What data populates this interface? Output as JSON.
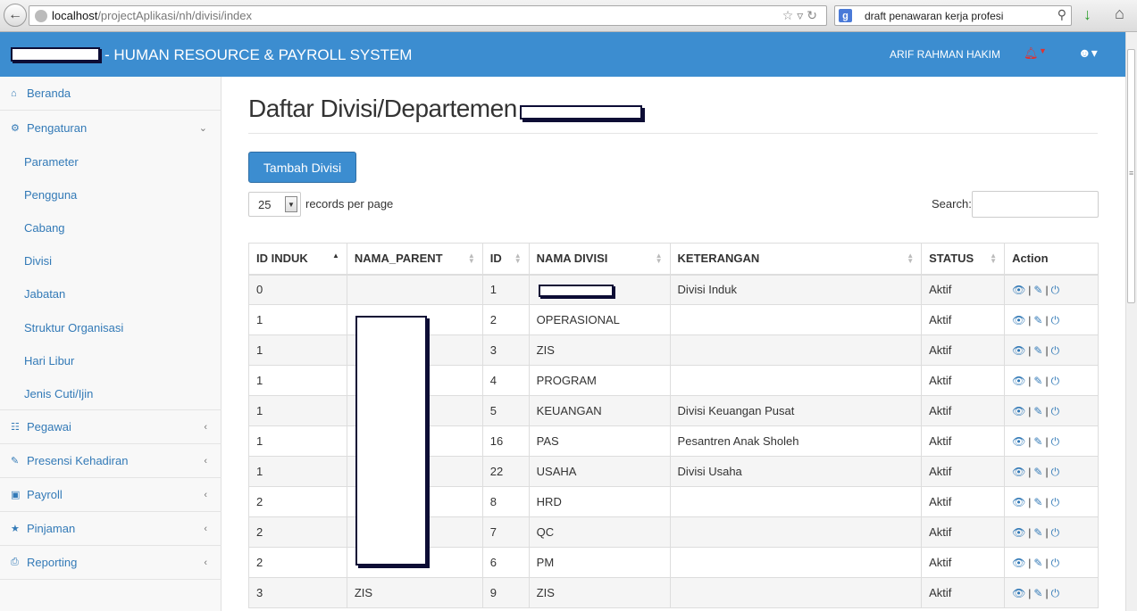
{
  "browser": {
    "url_host": "localhost",
    "url_path": "/projectAplikasi/nh/divisi/index",
    "search_query": "draft penawaran kerja profesi"
  },
  "header": {
    "title": "- HUMAN RESOURCE & PAYROLL SYSTEM",
    "user_name": "ARIF RAHMAN HAKIM",
    "brand_color": "#3c8dd0"
  },
  "sidebar": {
    "items": [
      {
        "label": "Beranda",
        "icon": "home-icon"
      },
      {
        "label": "Pengaturan",
        "icon": "cogs-icon"
      },
      {
        "label": "Pegawai",
        "icon": "sitemap-icon"
      },
      {
        "label": "Presensi Kehadiran",
        "icon": "edit-icon"
      },
      {
        "label": "Payroll",
        "icon": "money-icon"
      },
      {
        "label": "Pinjaman",
        "icon": "star-icon"
      },
      {
        "label": "Reporting",
        "icon": "print-icon"
      }
    ],
    "subitems": [
      "Parameter",
      "Pengguna",
      "Cabang",
      "Divisi",
      "Jabatan",
      "Struktur Organisasi",
      "Hari Libur",
      "Jenis Cuti/Ijin"
    ]
  },
  "main": {
    "title": "Daftar Divisi/Departemen",
    "add_button": "Tambah Divisi",
    "records_per_page_value": "25",
    "records_per_page_label": "records per page",
    "search_label": "Search:",
    "columns": [
      "ID INDUK",
      "NAMA_PARENT",
      "ID",
      "NAMA DIVISI",
      "KETERANGAN",
      "STATUS",
      "Action"
    ],
    "rows": [
      {
        "id_induk": "0",
        "nama_parent": "",
        "id": "1",
        "nama_divisi": "",
        "keterangan": "Divisi Induk",
        "status": "Aktif"
      },
      {
        "id_induk": "1",
        "nama_parent": "",
        "id": "2",
        "nama_divisi": "OPERASIONAL",
        "keterangan": "",
        "status": "Aktif"
      },
      {
        "id_induk": "1",
        "nama_parent": "",
        "id": "3",
        "nama_divisi": "ZIS",
        "keterangan": "",
        "status": "Aktif"
      },
      {
        "id_induk": "1",
        "nama_parent": "",
        "id": "4",
        "nama_divisi": "PROGRAM",
        "keterangan": "",
        "status": "Aktif"
      },
      {
        "id_induk": "1",
        "nama_parent": "",
        "id": "5",
        "nama_divisi": "KEUANGAN",
        "keterangan": "Divisi Keuangan Pusat",
        "status": "Aktif"
      },
      {
        "id_induk": "1",
        "nama_parent": "",
        "id": "16",
        "nama_divisi": "PAS",
        "keterangan": "Pesantren Anak Sholeh",
        "status": "Aktif"
      },
      {
        "id_induk": "1",
        "nama_parent": "",
        "id": "22",
        "nama_divisi": "USAHA",
        "keterangan": "Divisi Usaha",
        "status": "Aktif"
      },
      {
        "id_induk": "2",
        "nama_parent": "",
        "id": "8",
        "nama_divisi": "HRD",
        "keterangan": "",
        "status": "Aktif"
      },
      {
        "id_induk": "2",
        "nama_parent": "",
        "id": "7",
        "nama_divisi": "QC",
        "keterangan": "",
        "status": "Aktif"
      },
      {
        "id_induk": "2",
        "nama_parent": "",
        "id": "6",
        "nama_divisi": "PM",
        "keterangan": "",
        "status": "Aktif"
      },
      {
        "id_induk": "3",
        "nama_parent": "ZIS",
        "id": "9",
        "nama_divisi": "ZIS",
        "keterangan": "",
        "status": "Aktif"
      }
    ]
  }
}
